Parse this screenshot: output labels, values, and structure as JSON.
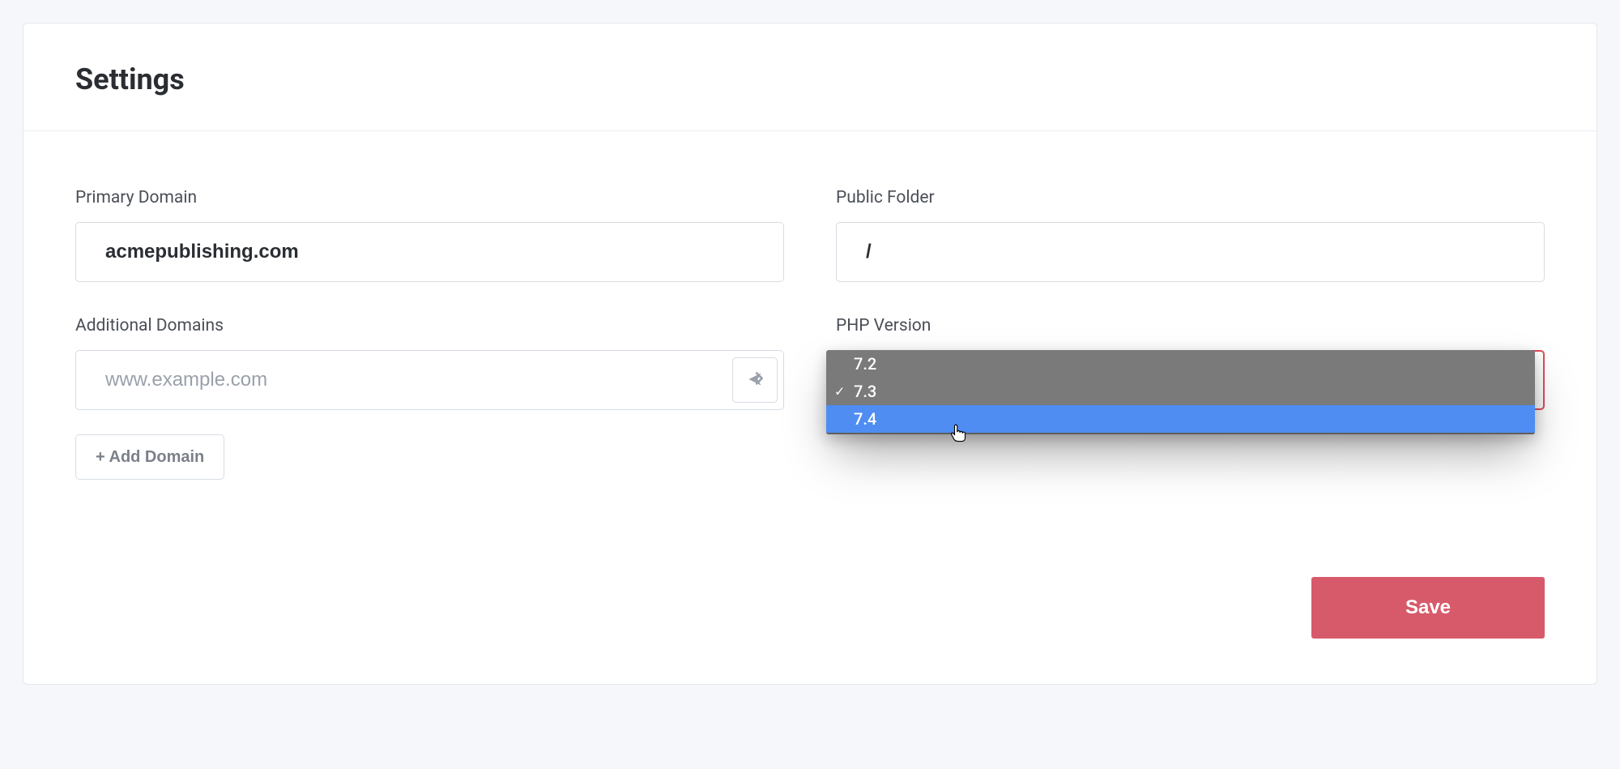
{
  "header": {
    "title": "Settings"
  },
  "primary_domain": {
    "label": "Primary Domain",
    "value": "acmepublishing.com"
  },
  "public_folder": {
    "label": "Public Folder",
    "value": "/"
  },
  "additional_domains": {
    "label": "Additional Domains",
    "placeholder": "www.example.com",
    "add_button": "+ Add Domain"
  },
  "php_version": {
    "label": "PHP Version",
    "selected": "7.3",
    "options": [
      {
        "value": "7.2",
        "checked": false,
        "highlight": false
      },
      {
        "value": "7.3",
        "checked": true,
        "highlight": false
      },
      {
        "value": "7.4",
        "checked": false,
        "highlight": true
      }
    ]
  },
  "actions": {
    "save": "Save"
  }
}
